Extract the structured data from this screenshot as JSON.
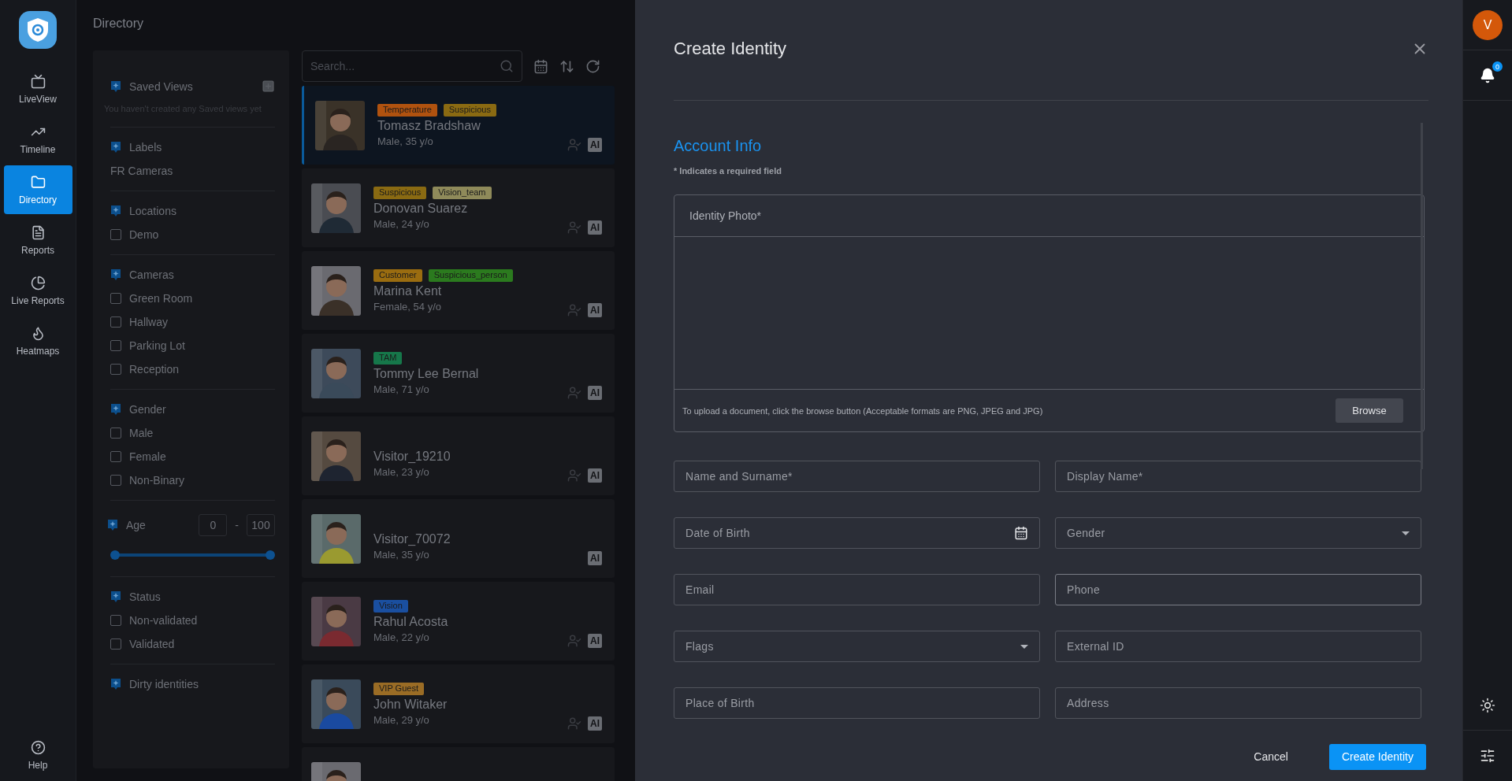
{
  "nav": {
    "items": [
      {
        "kind": "tv",
        "label": "LiveView",
        "selected": false
      },
      {
        "kind": "trend",
        "label": "Timeline",
        "selected": false
      },
      {
        "kind": "folder",
        "label": "Directory",
        "selected": true
      },
      {
        "kind": "file",
        "label": "Reports",
        "selected": false
      },
      {
        "kind": "pie",
        "label": "Live Reports",
        "selected": false
      },
      {
        "kind": "flame",
        "label": "Heatmaps",
        "selected": false
      }
    ],
    "help": {
      "label": "Help"
    }
  },
  "page_title": "Directory",
  "filters": [
    {
      "kind": "saved",
      "title": "Saved Views",
      "empty_text": "You haven't created any Saved views yet"
    },
    {
      "kind": "labels",
      "title": "Labels",
      "items": [
        "FR Cameras"
      ]
    },
    {
      "kind": "checks",
      "title": "Locations",
      "options": [
        {
          "label": "Demo",
          "checked": false
        }
      ]
    },
    {
      "kind": "checks",
      "title": "Cameras",
      "options": [
        {
          "label": "Green Room",
          "checked": false
        },
        {
          "label": "Hallway",
          "checked": false
        },
        {
          "label": "Parking Lot",
          "checked": false
        },
        {
          "label": "Reception",
          "checked": false
        }
      ]
    },
    {
      "kind": "checks",
      "title": "Gender",
      "options": [
        {
          "label": "Male",
          "checked": false
        },
        {
          "label": "Female",
          "checked": false
        },
        {
          "label": "Non-Binary",
          "checked": false
        }
      ]
    },
    {
      "kind": "age",
      "title": "Age",
      "min": "0",
      "separator": "-",
      "max": "100",
      "thumbs": [
        {
          "level": 0
        },
        {
          "level": 1
        }
      ]
    },
    {
      "kind": "checks",
      "title": "Status",
      "options": [
        {
          "label": "Non-validated",
          "checked": false
        },
        {
          "label": "Validated",
          "checked": false
        }
      ]
    },
    {
      "kind": "heading",
      "title": "Dirty identities"
    }
  ],
  "list": {
    "search": {
      "placeholder": "Search..."
    },
    "cards": [
      {
        "selected": true,
        "tags": [
          {
            "label": "Temperature",
            "color": "#b0520f"
          },
          {
            "label": "Suspicious",
            "color": "#8a6a12"
          }
        ],
        "name": "Tomasz Bradshaw",
        "info": "Male, 35 y/o",
        "validated": true,
        "ai": "AI"
      },
      {
        "selected": false,
        "tags": [
          {
            "label": "Suspicious",
            "color": "#8a6a12"
          },
          {
            "label": "Vision_team",
            "color": "#8f8a5a"
          }
        ],
        "name": "Donovan Suarez",
        "info": "Male, 24 y/o",
        "validated": true,
        "ai": "AI"
      },
      {
        "selected": false,
        "tags": [
          {
            "label": "Customer",
            "color": "#9a6c10"
          },
          {
            "label": "Suspicious_person",
            "color": "#2b7a1e"
          }
        ],
        "name": "Marina Kent",
        "info": "Female, 54 y/o",
        "validated": true,
        "ai": "AI"
      },
      {
        "selected": false,
        "tags": [
          {
            "label": "TAM",
            "color": "#16774a"
          }
        ],
        "name": "Tommy Lee Bernal",
        "info": "Male, 71 y/o",
        "validated": true,
        "ai": "AI"
      },
      {
        "selected": false,
        "name": "Visitor_19210",
        "info": "Male, 23 y/o",
        "validated": true,
        "ai": "AI"
      },
      {
        "selected": false,
        "name": "Visitor_70072",
        "info": "Male, 35 y/o",
        "validated": false,
        "ai": "AI"
      },
      {
        "selected": false,
        "tags": [
          {
            "label": "Vision",
            "color": "#1a4fa0"
          }
        ],
        "name": "Rahul Acosta",
        "info": "Male, 22 y/o",
        "validated": true,
        "ai": "AI"
      },
      {
        "selected": false,
        "tags": [
          {
            "label": "VIP Guest",
            "color": "#9a6c25"
          }
        ],
        "name": "John Witaker",
        "info": "Male, 29 y/o",
        "validated": true,
        "ai": "AI"
      }
    ]
  },
  "modal": {
    "title": "Create Identity",
    "section": "Account Info",
    "required_note": "* Indicates a required field",
    "photo": {
      "label": "Identity Photo*",
      "hint": "To upload a document, click the browse button (Acceptable formats are PNG, JPEG and JPG)",
      "button": "Browse"
    },
    "fields": [
      {
        "kind": "text",
        "placeholder": "Name and Surname*",
        "focused": false
      },
      {
        "kind": "text",
        "placeholder": "Display Name*",
        "focused": false
      },
      {
        "kind": "date",
        "placeholder": "Date of Birth",
        "focused": false
      },
      {
        "kind": "select",
        "placeholder": "Gender",
        "focused": false
      },
      {
        "kind": "text",
        "placeholder": "Email",
        "focused": false
      },
      {
        "kind": "text",
        "placeholder": "Phone",
        "focused": true
      },
      {
        "kind": "select",
        "placeholder": "Flags",
        "focused": false
      },
      {
        "kind": "text",
        "placeholder": "External ID",
        "focused": false
      },
      {
        "kind": "text",
        "placeholder": "Place of Birth",
        "focused": false
      },
      {
        "kind": "text",
        "placeholder": "Address",
        "focused": false
      }
    ],
    "cancel": "Cancel",
    "submit": "Create Identity"
  },
  "rightbar": {
    "avatar": "V",
    "notifications": "0"
  }
}
